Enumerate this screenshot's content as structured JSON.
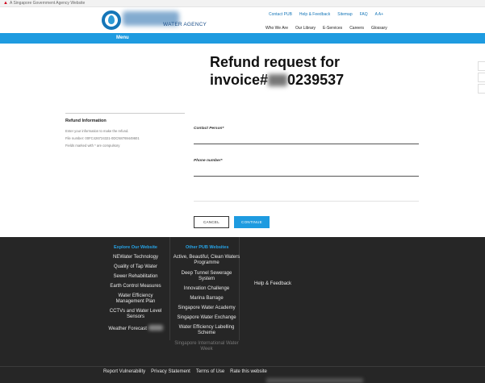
{
  "gov_strip": {
    "text": "A Singapore Government Agency Website"
  },
  "header": {
    "logo_text": "WATER AGENCY",
    "top_links": [
      "Contact PUB",
      "Help & Feedback",
      "Sitemap",
      "FAQ",
      "A  A+"
    ],
    "main_nav": [
      "Who We Are",
      "Our Library",
      "E-Services",
      "Careers",
      "Glossary"
    ],
    "menu_label": "Menu"
  },
  "main": {
    "title_line1": "Refund request for",
    "title_prefix": "invoice#",
    "title_suffix": "0239537"
  },
  "info": {
    "heading": "Refund Information",
    "lines": [
      "Enter your information to make the refund.",
      "File number: 00FC426724321-0DCN8769449601",
      "Fields marked with * are compulsory"
    ]
  },
  "form": {
    "contact_label": "Contact Person*",
    "contact_value": "",
    "phone_label": "Phone number*",
    "phone_value": "",
    "cancel_label": "CANCEL",
    "continue_label": "CONTINUE"
  },
  "footer": {
    "explore_heading": "Explore Our Website",
    "explore_links": [
      "NEWater Technology",
      "Quality of Tap Water",
      "Sewer Rehabilitation",
      "Earth Control Measures",
      "Water Efficiency Management Plan",
      "CCTVs and Water Level Sensors",
      "Weather Forecast"
    ],
    "other_heading": "Other PUB Websites",
    "other_links": [
      "Active, Beautiful, Clean Waters Programme",
      "Deep Tunnel Sewerage System",
      "Innovation Challenge",
      "Marina Barrage",
      "Singapore Water Academy",
      "Singapore Water Exchange",
      "Water Efficiency Labelling Scheme",
      "Singapore International Water Week"
    ],
    "help_link": "Help & Feedback",
    "bottom_links": [
      "Report Vulnerability",
      "Privacy Statement",
      "Terms of Use",
      "Rate this website"
    ]
  },
  "colors": {
    "brand_blue": "#1e9be0",
    "footer_bg": "#262626",
    "footer_heading": "#26a3e6"
  }
}
